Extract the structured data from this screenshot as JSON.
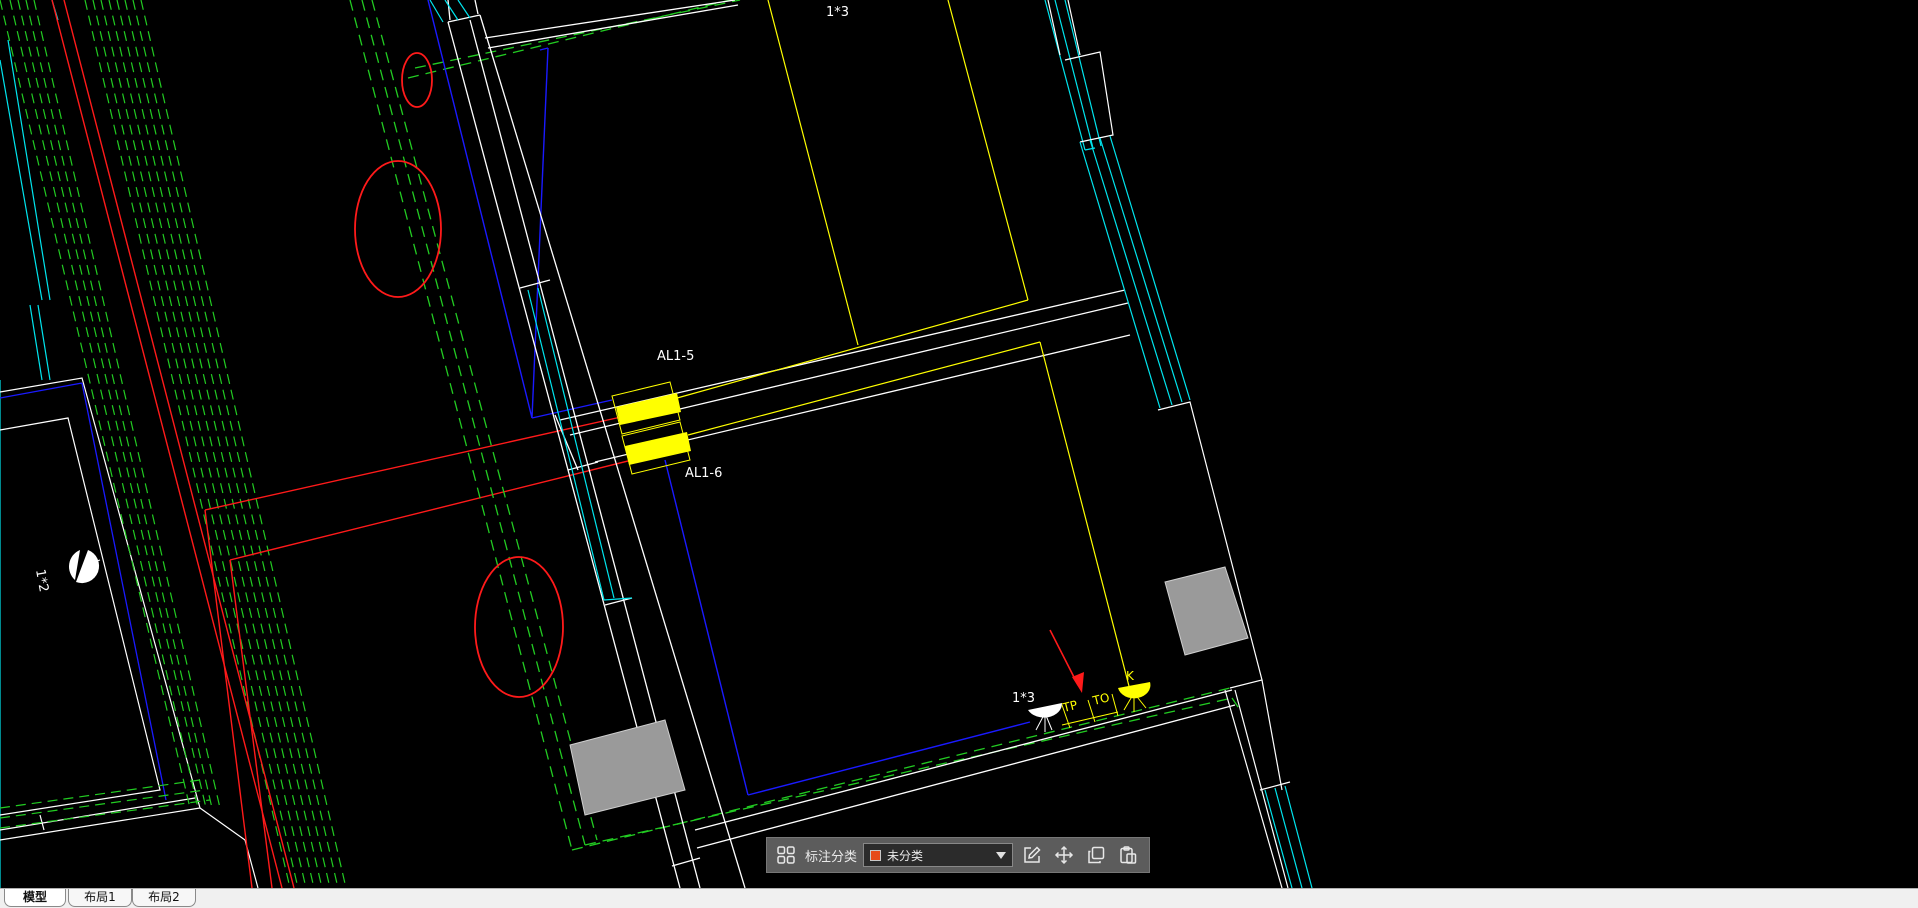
{
  "drawing": {
    "labels": {
      "top_fixture_count": "1*3",
      "left_fixture_count": "1*2",
      "panel_upper": "AL1-5",
      "panel_lower": "AL1-6",
      "right_fixture_count": "1*3",
      "socket_tp": "TP",
      "socket_to": "TO",
      "switch_k": "K"
    }
  },
  "toolbar": {
    "grid_icon": "grid-icon",
    "category_label": "标注分类",
    "category_value": "未分类",
    "category_color": "#e64a19",
    "edit_icon": "edit-icon",
    "move_icon": "move-icon",
    "copy_icon": "copy-icon",
    "paste_icon": "paste-icon"
  },
  "tabs": [
    {
      "label": "模型",
      "active": true
    },
    {
      "label": "布局1",
      "active": false
    },
    {
      "label": "布局2",
      "active": false
    }
  ],
  "colors": {
    "background": "#000000",
    "wall": "#ffffff",
    "cyan": "#00e5ee",
    "green_dashed": "#22cc22",
    "red": "#ff1a1a",
    "blue": "#1a1aff",
    "yellow": "#ffff00",
    "gray_block": "#9a9a9a"
  }
}
